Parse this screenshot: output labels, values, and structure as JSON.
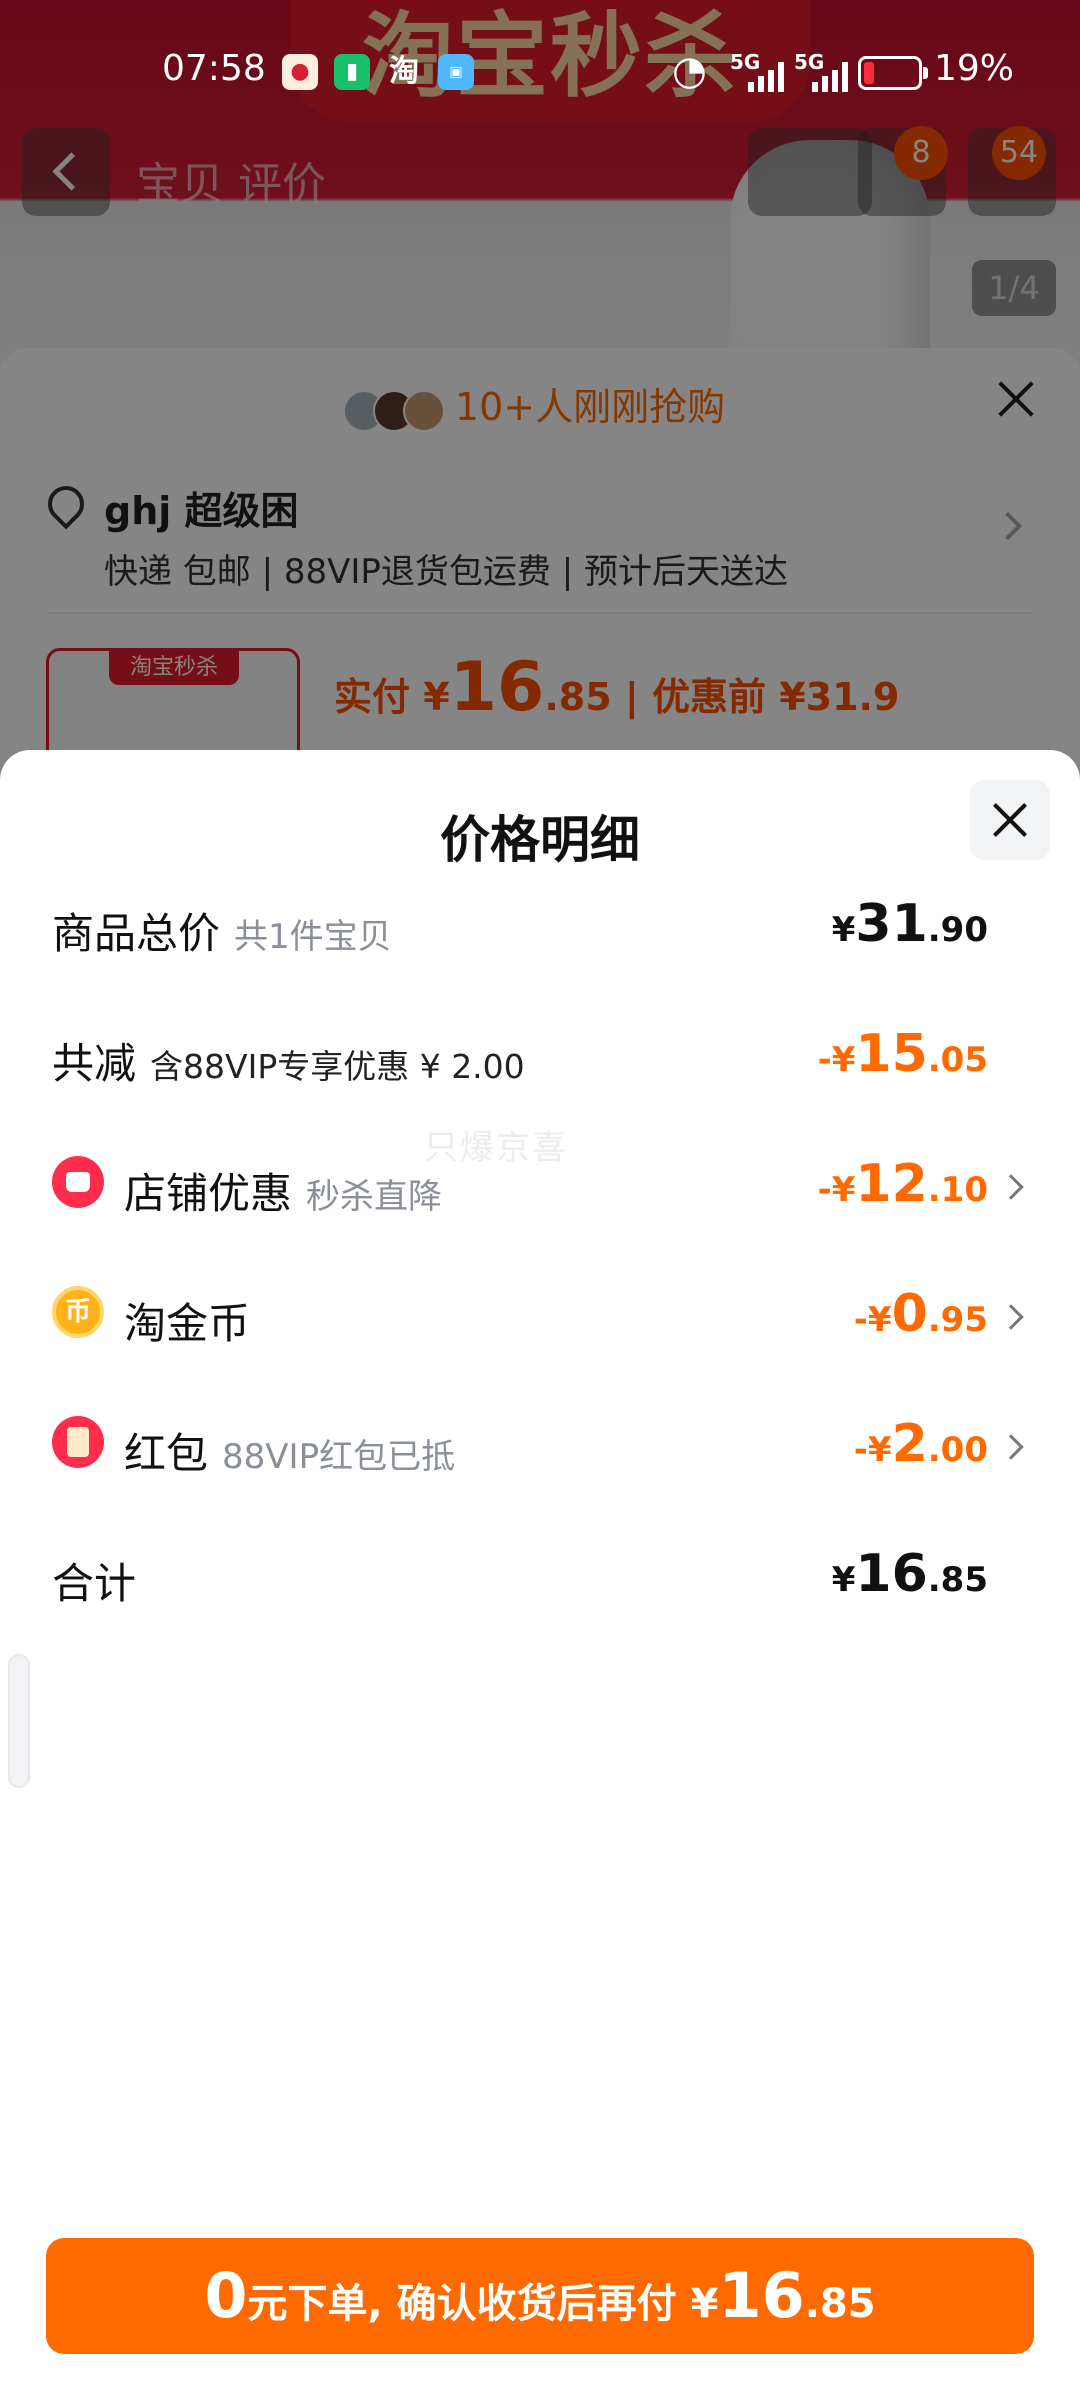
{
  "status_bar": {
    "time": "07:58",
    "app_icons": [
      "news-app-icon",
      "battery-saver-icon",
      "taobao-icon",
      "game-app-icon"
    ],
    "taobao_glyph": "淘",
    "signal_labels": [
      "5G",
      "5G"
    ],
    "battery_percent": "19%",
    "battery_level": 0.19
  },
  "background_page": {
    "banner_text": "淘宝秒杀",
    "tabs_text": "宝贝 评价",
    "cart_badge": "8",
    "more_badge": "54",
    "image_counter": "1/4",
    "buyers_text": "10+人刚刚抢购",
    "address_name": "ghj 超级困",
    "delivery_text": "快递 包邮 | 88VIP退货包运费 | 预计后天送达",
    "thumb_tag": "淘宝秒杀",
    "price_prefix": "实付 ¥",
    "price_int": "16",
    "price_dec": ".85",
    "original_price": " | 优惠前 ¥31.9"
  },
  "sheet": {
    "title": "价格明细",
    "watermark": "只爆京喜",
    "rows": [
      {
        "label": "商品总价",
        "sub": "共1件宝贝",
        "prefix": "¥",
        "int": "31",
        "dec": ".90"
      },
      {
        "label": "共减",
        "sub": "含88VIP专享优惠 ¥ 2.00",
        "prefix": "-¥",
        "int": "15",
        "dec": ".05"
      },
      {
        "label": "店铺优惠",
        "sub": "秒杀直降",
        "prefix": "-¥",
        "int": "12",
        "dec": ".10",
        "icon": "store-icon"
      },
      {
        "label": "淘金币",
        "sub": "",
        "prefix": "-¥",
        "int": "0",
        "dec": ".95",
        "icon": "coin-icon"
      },
      {
        "label": "红包",
        "sub": "88VIP红包已抵",
        "prefix": "-¥",
        "int": "2",
        "dec": ".00",
        "icon": "red-packet-icon"
      },
      {
        "label": "合计",
        "sub": "",
        "prefix": "¥",
        "int": "16",
        "dec": ".85"
      }
    ]
  },
  "cta": {
    "zero": "0",
    "text": "元下单, 确认收货后再付 ¥",
    "int": "16",
    "dec": ".85"
  },
  "colors": {
    "accent": "#ff6a00",
    "brand_red": "#e21b2f",
    "sheet_bg": "#ffffff"
  }
}
